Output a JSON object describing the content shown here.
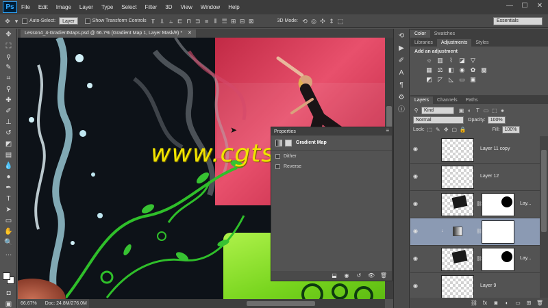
{
  "app": {
    "logo": "Ps"
  },
  "menu": [
    "File",
    "Edit",
    "Image",
    "Layer",
    "Type",
    "Select",
    "Filter",
    "3D",
    "View",
    "Window",
    "Help"
  ],
  "window_controls": {
    "minimize": "—",
    "maximize": "☐",
    "close": "✕"
  },
  "options_bar": {
    "auto_select_label": "Auto-Select:",
    "auto_select_value": "Layer",
    "show_transform_label": "Show Transform Controls",
    "mode_3d_label": "3D Mode:",
    "workspace": "Essentials"
  },
  "document": {
    "tab_title": "Lesson4_4-GradientMaps.psd @ 66.7% (Gradient Map 1, Layer Mask/8) *",
    "zoom": "66.67%",
    "doc_size": "Doc: 24.8M/276.0M"
  },
  "watermark": "www.cgtsj.com",
  "properties": {
    "title": "Properties",
    "adjustment_name": "Gradient Map",
    "options": [
      "Dither",
      "Reverse"
    ]
  },
  "color_panel": {
    "tabs": [
      "Color",
      "Swatches"
    ]
  },
  "adjustments_panel": {
    "tabs": [
      "Libraries",
      "Adjustments",
      "Styles"
    ],
    "active_tab": "Adjustments",
    "title": "Add an adjustment"
  },
  "layers_panel": {
    "tabs": [
      "Layers",
      "Channels",
      "Paths"
    ],
    "filter_kind": "Kind",
    "blend_mode": "Normal",
    "opacity_label": "Opacity:",
    "opacity_value": "100%",
    "lock_label": "Lock:",
    "fill_label": "Fill:",
    "fill_value": "100%",
    "layers": [
      {
        "name": "Layer 11 copy"
      },
      {
        "name": "Layer 12"
      },
      {
        "name": "Lay..."
      },
      {
        "name": ""
      },
      {
        "name": "Lay..."
      },
      {
        "name": "Layer 9"
      }
    ]
  },
  "colors": {
    "accent_selected_layer": "#8b9ab3",
    "watermark": "#f1e400",
    "app_dark": "#3c3c3c"
  }
}
